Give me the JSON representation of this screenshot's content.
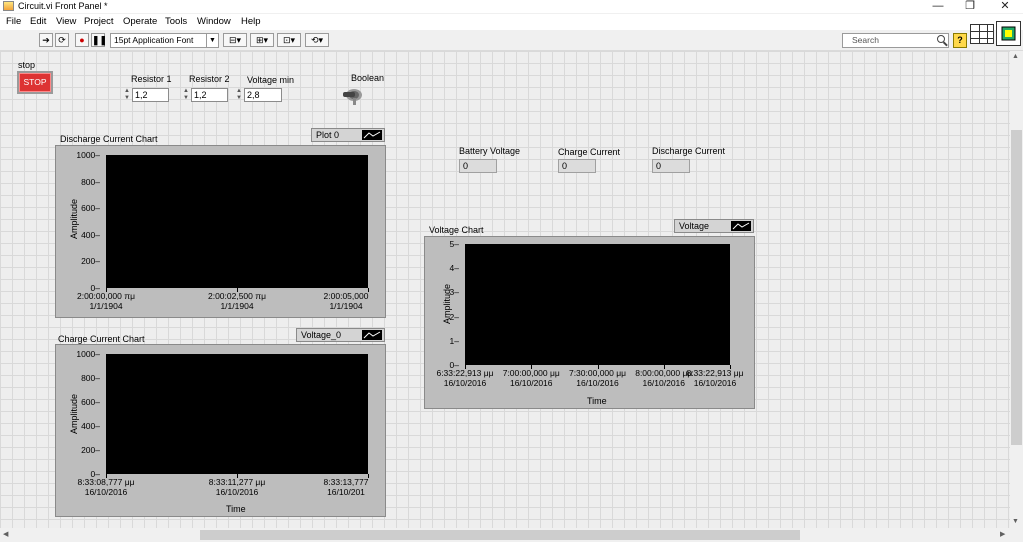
{
  "window": {
    "title": "Circuit.vi Front Panel *",
    "minimize": "—",
    "restore": "❐",
    "close": "✕"
  },
  "menubar": [
    "File",
    "Edit",
    "View",
    "Project",
    "Operate",
    "Tools",
    "Window",
    "Help"
  ],
  "toolbar": {
    "font": "15pt Application Font",
    "search_placeholder": "Search",
    "help": "?"
  },
  "controls": {
    "stop": {
      "label": "stop",
      "button": "STOP"
    },
    "resistor1": {
      "label": "Resistor 1",
      "value": "1,2"
    },
    "resistor2": {
      "label": "Resistor 2",
      "value": "1,2"
    },
    "voltage_min": {
      "label": "Voltage min",
      "value": "2,8"
    },
    "boolean": {
      "label": "Boolean"
    }
  },
  "indicators": {
    "battery_voltage": {
      "label": "Battery Voltage",
      "value": "0"
    },
    "charge_current": {
      "label": "Charge Current",
      "value": "0"
    },
    "discharge_current": {
      "label": "Discharge Current",
      "value": "0"
    }
  },
  "charts": {
    "discharge": {
      "title": "Discharge Current Chart",
      "legend": "Plot 0",
      "ylabel": "Amplitude",
      "yticks": [
        "1000",
        "800",
        "600",
        "400",
        "200",
        "0"
      ],
      "xticks": [
        [
          "2:00:00,000 πμ",
          "1/1/1904"
        ],
        [
          "2:00:02,500 πμ",
          "1/1/1904"
        ],
        [
          "2:00:05,000",
          "1/1/1904"
        ]
      ]
    },
    "charge": {
      "title": "Charge Current Chart",
      "legend": "Voltage_0",
      "ylabel": "Amplitude",
      "xlabel": "Time",
      "yticks": [
        "1000",
        "800",
        "600",
        "400",
        "200",
        "0"
      ],
      "xticks": [
        [
          "8:33:08,777 μμ",
          "16/10/2016"
        ],
        [
          "8:33:11,277 μμ",
          "16/10/2016"
        ],
        [
          "8:33:13,777",
          "16/10/201"
        ]
      ]
    },
    "voltage": {
      "title": "Voltage Chart",
      "legend": "Voltage",
      "ylabel": "Amplitude",
      "xlabel": "Time",
      "yticks": [
        "5",
        "4",
        "3",
        "2",
        "1",
        "0"
      ],
      "xticks": [
        [
          "6:33:22,913 μμ",
          "16/10/2016"
        ],
        [
          "7:00:00,000 μμ",
          "16/10/2016"
        ],
        [
          "7:30:00,000 μμ",
          "16/10/2016"
        ],
        [
          "8:00:00,000 μμ",
          "16/10/2016"
        ],
        [
          "8:33:22,913 μμ",
          "16/10/2016"
        ]
      ]
    }
  },
  "colors": {
    "stop_button": "#dd3333",
    "plot_background": "#000000",
    "chart_frame": "#bdbdbd"
  }
}
